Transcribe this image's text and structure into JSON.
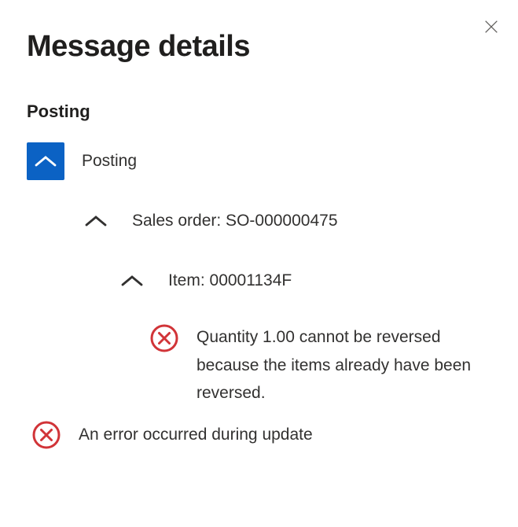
{
  "title": "Message details",
  "section_heading": "Posting",
  "tree": {
    "root_label": "Posting",
    "level1_label": "Sales order: SO-000000475",
    "level2_label": "Item: 00001134F",
    "error_detail": "Quantity 1.00 cannot be reversed because the items already have been reversed.",
    "error_summary": "An error occurred during update"
  }
}
